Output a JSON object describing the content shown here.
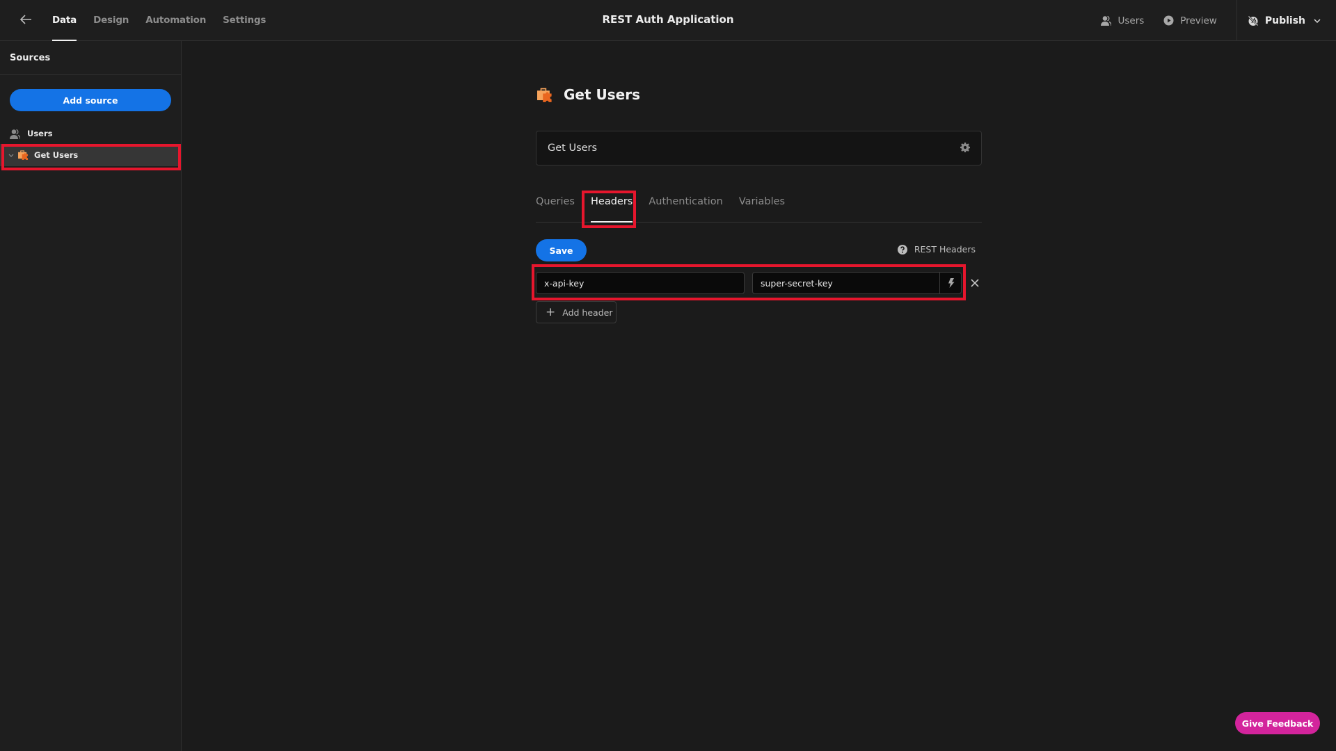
{
  "topbar": {
    "back_icon": "arrow-left-icon",
    "tabs": [
      {
        "label": "Data",
        "active": true
      },
      {
        "label": "Design",
        "active": false
      },
      {
        "label": "Automation",
        "active": false
      },
      {
        "label": "Settings",
        "active": false
      }
    ],
    "app_title": "REST Auth Application",
    "users_label": "Users",
    "preview_label": "Preview",
    "publish_label": "Publish"
  },
  "sidebar": {
    "title": "Sources",
    "add_source_label": "Add source",
    "items": [
      {
        "label": "Users",
        "icon": "users-icon",
        "selected": false
      },
      {
        "label": "Get Users",
        "icon": "rest-api-icon",
        "selected": true,
        "expanded": true
      }
    ]
  },
  "datasource": {
    "title": "Get Users",
    "name_value": "Get Users",
    "tabs": [
      {
        "label": "Queries",
        "active": false
      },
      {
        "label": "Headers",
        "active": true
      },
      {
        "label": "Authentication",
        "active": false
      },
      {
        "label": "Variables",
        "active": false
      }
    ],
    "save_label": "Save",
    "help_label": "REST Headers",
    "headers": [
      {
        "key": "x-api-key",
        "value": "super-secret-key"
      }
    ],
    "add_header_label": "Add header"
  },
  "feedback_label": "Give Feedback",
  "colors": {
    "accent": "#1473e6",
    "feedback": "#d3249c",
    "highlight": "#e6162d",
    "rest_icon_light": "#f6a35b",
    "rest_icon_dark": "#e9661f"
  }
}
